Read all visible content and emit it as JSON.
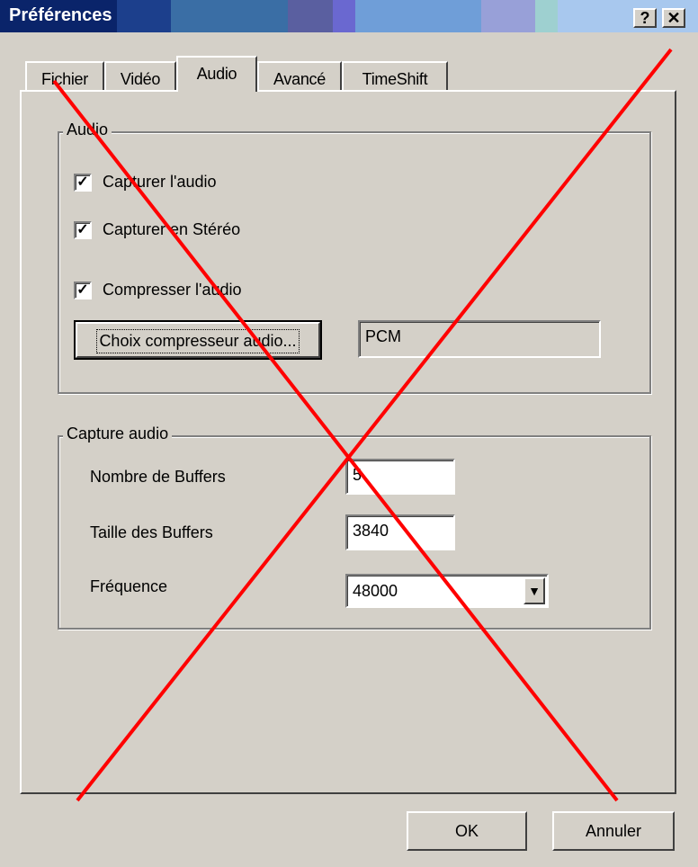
{
  "window": {
    "title": "Préférences",
    "help_button": "?",
    "close_button": "✕"
  },
  "tabs": [
    {
      "label": "Fichier",
      "active": false
    },
    {
      "label": "Vidéo",
      "active": false
    },
    {
      "label": "Audio",
      "active": true
    },
    {
      "label": "Avancé",
      "active": false
    },
    {
      "label": "TimeShift",
      "active": false
    }
  ],
  "audio_group": {
    "label": "Audio",
    "capture_audio": {
      "label": "Capturer l'audio",
      "checked": true
    },
    "capture_stereo": {
      "label": "Capturer en Stéréo",
      "checked": true
    },
    "compress_audio": {
      "label": "Compresser l'audio",
      "checked": true
    },
    "choose_compressor_button": "Choix compresseur audio...",
    "compressor_value": "PCM"
  },
  "capture_group": {
    "label": "Capture audio",
    "buffer_count_label": "Nombre de Buffers",
    "buffer_count_value": "5",
    "buffer_size_label": "Taille des Buffers",
    "buffer_size_value": "3840",
    "frequency_label": "Fréquence",
    "frequency_value": "48000"
  },
  "footer": {
    "ok_button": "OK",
    "cancel_button": "Annuler"
  },
  "colors": {
    "cross": "#ff0000",
    "title_text": "#ffffff",
    "face": "#d4d0c8"
  }
}
